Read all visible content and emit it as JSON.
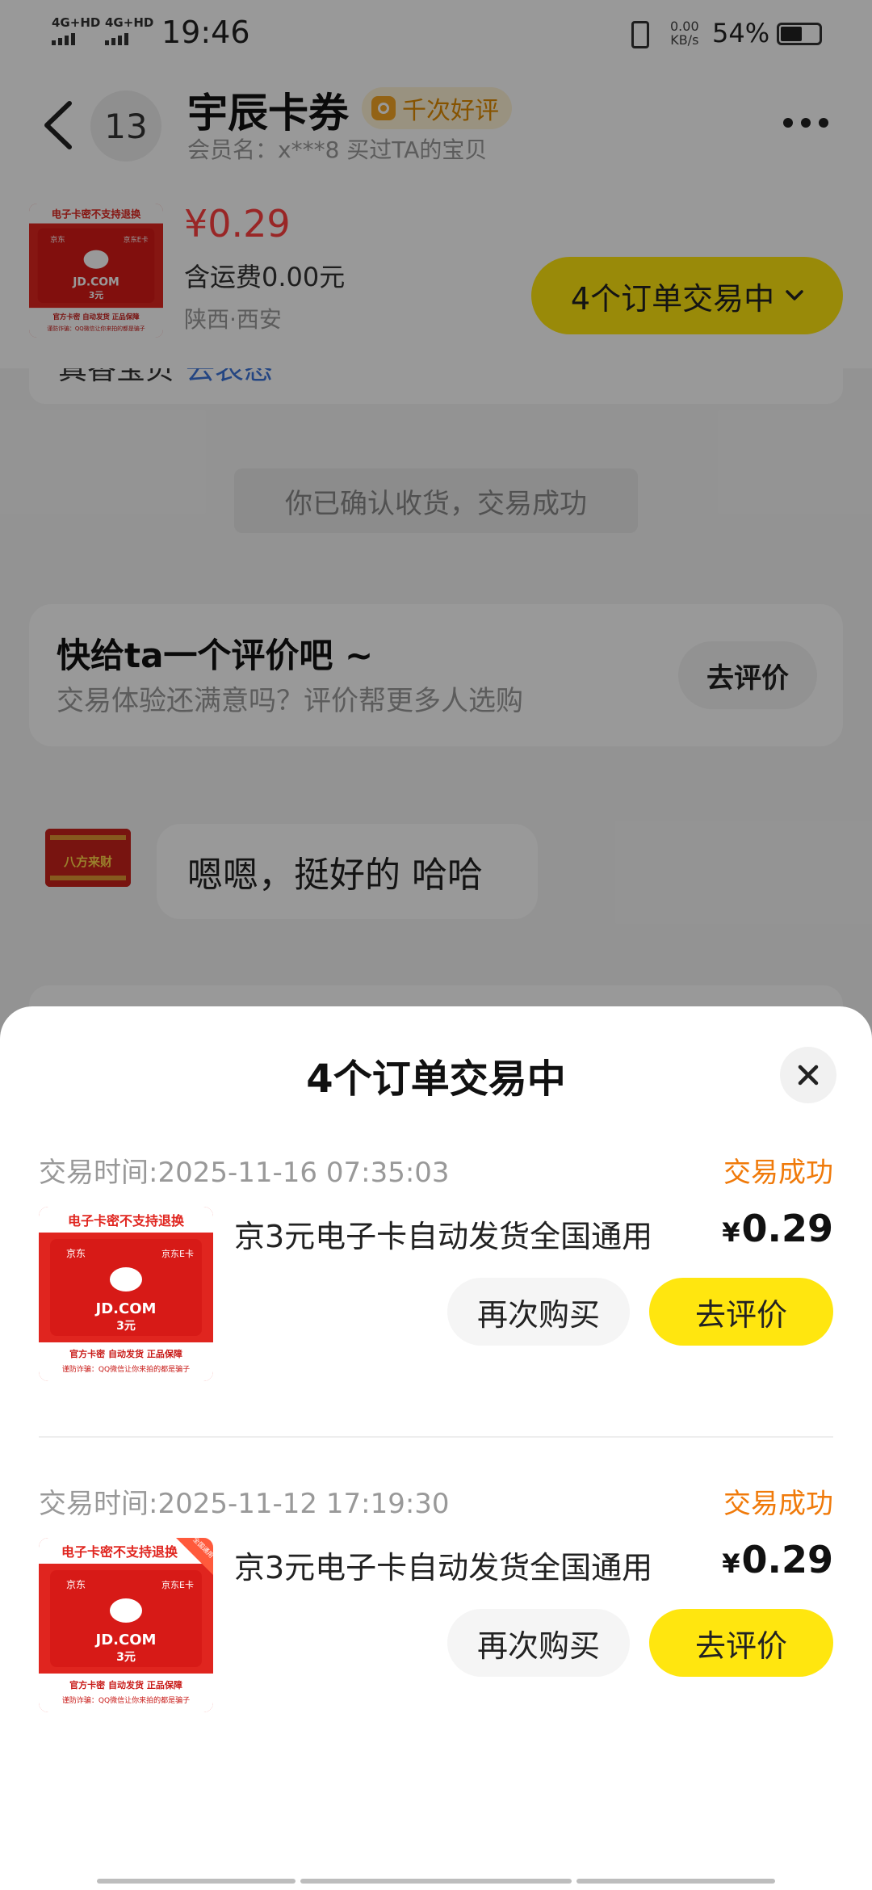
{
  "status_bar": {
    "signal_1": "4G+HD",
    "signal_2": "4G+HD",
    "time": "19:46",
    "net_speed_value": "0.00",
    "net_speed_unit": "KB/s",
    "battery": "54%",
    "battery_level": 0.54
  },
  "header": {
    "unread_count": "13",
    "shop_name": "宇辰卡券",
    "badge": "千次好评",
    "member_line": "会员名：x***8    买过TA的宝贝"
  },
  "item_bar": {
    "price": "¥0.29",
    "shipping": "含运费0.00元",
    "location": "陕西·西安",
    "orders_button": "4个订单交易中"
  },
  "chat": {
    "prev_card_text": "真香宝贝",
    "prev_card_link": "去表态",
    "system_message": "你已确认收货，交易成功",
    "rate_card": {
      "title": "快给ta一个评价吧 ~",
      "subtitle": "交易体验还满意吗？评价帮更多人选购",
      "button": "去评价"
    },
    "bubble": "嗯嗯，挺好的 哈哈"
  },
  "thumb": {
    "top_text": "电子卡密不支持退换",
    "brand_small": "京东",
    "ecard": "京东E卡",
    "domain": "JD.COM",
    "amount": "3元",
    "tags": "官方卡密  自动发货  正品保障",
    "warning": "谨防诈骗：QQ微信让你来拍的都是骗子",
    "corner": "全国通用",
    "avatar_text": "八方来财"
  },
  "sheet": {
    "title": "4个订单交易中",
    "orders": [
      {
        "time": "交易时间:2025-11-16 07:35:03",
        "status": "交易成功",
        "name": "京3元电子卡自动发货全国通用",
        "currency": "¥",
        "price": "0.29",
        "again_button": "再次购买",
        "rate_button": "去评价"
      },
      {
        "time": "交易时间:2025-11-12 17:19:30",
        "status": "交易成功",
        "name": "京3元电子卡自动发货全国通用",
        "currency": "¥",
        "price": "0.29",
        "again_button": "再次购买",
        "rate_button": "去评价"
      }
    ]
  },
  "colors": {
    "accent_yellow": "#ffe60f",
    "price_red": "#ff4040",
    "status_orange": "#f07a0a",
    "badge_orange": "#e08b00",
    "link_blue": "#3b73d9",
    "jd_red": "#e0251f"
  },
  "icons": [
    "back-arrow-icon",
    "more-icon",
    "chevron-down-icon",
    "close-icon",
    "vibrate-icon",
    "battery-icon",
    "badge-icon"
  ]
}
